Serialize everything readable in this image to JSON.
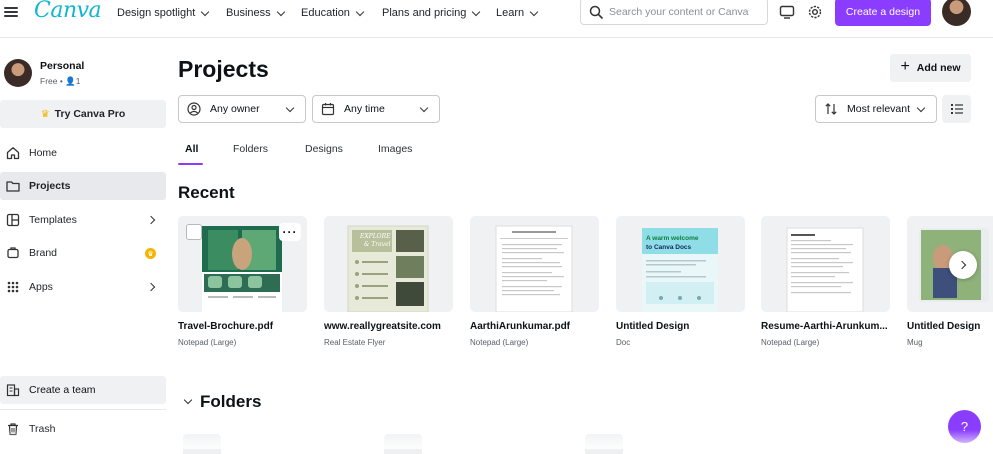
{
  "app": {
    "logo_text": "Canva",
    "brand_color": "#12b6d1",
    "accent_color": "#8b3dff"
  },
  "nav": {
    "items": [
      {
        "label": "Design spotlight"
      },
      {
        "label": "Business"
      },
      {
        "label": "Education"
      },
      {
        "label": "Plans and pricing"
      },
      {
        "label": "Learn"
      }
    ]
  },
  "search": {
    "placeholder": "Search your content or Canva"
  },
  "header": {
    "create_label": "Create a design",
    "icons": [
      "desktop-icon",
      "gear-icon"
    ]
  },
  "sidebar": {
    "profile": {
      "name": "Personal",
      "sub": "Free • 👤1"
    },
    "try_pro": "Try Canva Pro",
    "items": [
      {
        "label": "Home",
        "icon": "home-icon"
      },
      {
        "label": "Projects",
        "icon": "folder-icon",
        "active": true
      },
      {
        "label": "Templates",
        "icon": "templates-icon"
      },
      {
        "label": "Brand",
        "icon": "brand-icon"
      },
      {
        "label": "Apps",
        "icon": "apps-icon"
      }
    ],
    "team": "Create a team",
    "trash": "Trash"
  },
  "main": {
    "title": "Projects",
    "add_new": "Add new",
    "filters": {
      "owner": "Any owner",
      "time": "Any time",
      "sort": "Most relevant"
    },
    "tabs": [
      {
        "label": "All",
        "active": true
      },
      {
        "label": "Folders"
      },
      {
        "label": "Designs"
      },
      {
        "label": "Images"
      }
    ],
    "recent_heading": "Recent",
    "recent": [
      {
        "title": "Travel-Brochure.pdf",
        "sub": "Notepad (Large)"
      },
      {
        "title": "www.reallygreatsite.com",
        "sub": "Real Estate Flyer"
      },
      {
        "title": "AarthiArunkumar.pdf",
        "sub": "Notepad (Large)"
      },
      {
        "title": "Untitled Design",
        "sub": "Doc"
      },
      {
        "title": "Resume-Aarthi-Arunkum...",
        "sub": "Notepad (Large)"
      },
      {
        "title": "Untitled Design",
        "sub": "Mug"
      }
    ],
    "thumb_text": {
      "doc_welcome_1": "A warm welcome",
      "doc_welcome_2": "to Canva Docs",
      "flyer_title_1": "EXPLORE",
      "flyer_title_2": "& Travel"
    },
    "folders_heading": "Folders"
  },
  "help": {
    "label": "?"
  }
}
